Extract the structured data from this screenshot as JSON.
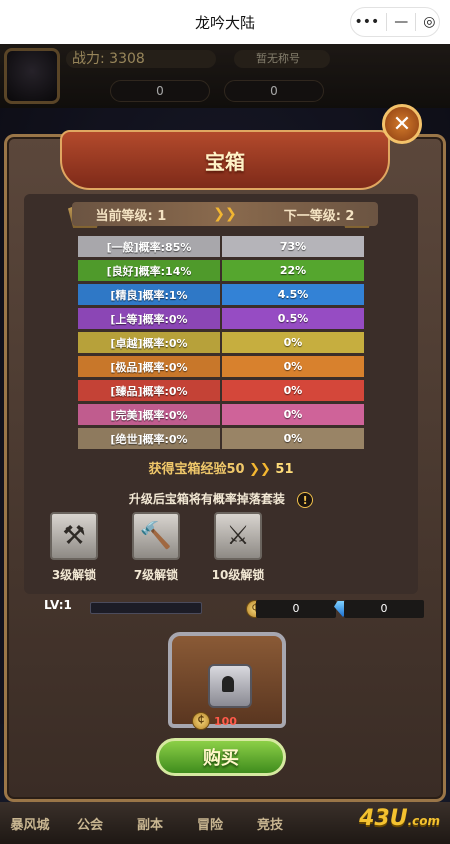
{
  "app": {
    "title": "龙吟大陆",
    "capsule": {
      "more": "•••",
      "minimize": "—",
      "close": "◎"
    }
  },
  "hud": {
    "power_label": "战力:",
    "power_value": "3308",
    "rank_label": "暂无称号",
    "coin_value": "0",
    "gem_value": "0"
  },
  "dialog": {
    "title": "宝箱",
    "close_label": "✕",
    "current_level_label": "当前等级: 1",
    "next_level_label": "下一等级: 2",
    "rates": [
      {
        "label": "[一般]概率:85%",
        "value": "73%",
        "color": "#a8a7ab"
      },
      {
        "label": "[良好]概率:14%",
        "value": "22%",
        "color": "#4f9a2b"
      },
      {
        "label": "[精良]概率:1%",
        "value": "4.5%",
        "color": "#2f78c6"
      },
      {
        "label": "[上等]概率:0%",
        "value": "0.5%",
        "color": "#8b46b5"
      },
      {
        "label": "[卓越]概率:0%",
        "value": "0%",
        "color": "#b7a13a"
      },
      {
        "label": "[极品]概率:0%",
        "value": "0%",
        "color": "#c8772a"
      },
      {
        "label": "[臻品]概率:0%",
        "value": "0%",
        "color": "#c44236"
      },
      {
        "label": "[完美]概率:0%",
        "value": "0%",
        "color": "#c05c8e"
      },
      {
        "label": "[绝世]概率:0%",
        "value": "0%",
        "color": "#8e7a5e"
      }
    ],
    "exp_text": "获得宝箱经验50",
    "exp_next": "51",
    "upgrade_note": "升级后宝箱将有概率掉落套装",
    "unlocks": [
      "3级解锁",
      "7级解锁",
      "10级解锁"
    ],
    "icons": [
      "axe-icon",
      "hammer-icon",
      "mace-icon"
    ]
  },
  "lower": {
    "level_label": "LV:1",
    "exp_progress_percent": 0,
    "coin_value": "0",
    "gem_value": "0",
    "cost_value": "100",
    "buy_label": "购买"
  },
  "nav": {
    "items": [
      "暴风城",
      "公会",
      "副本",
      "冒险",
      "竞技"
    ],
    "logo": "43U",
    "logo_suffix": ".com"
  }
}
